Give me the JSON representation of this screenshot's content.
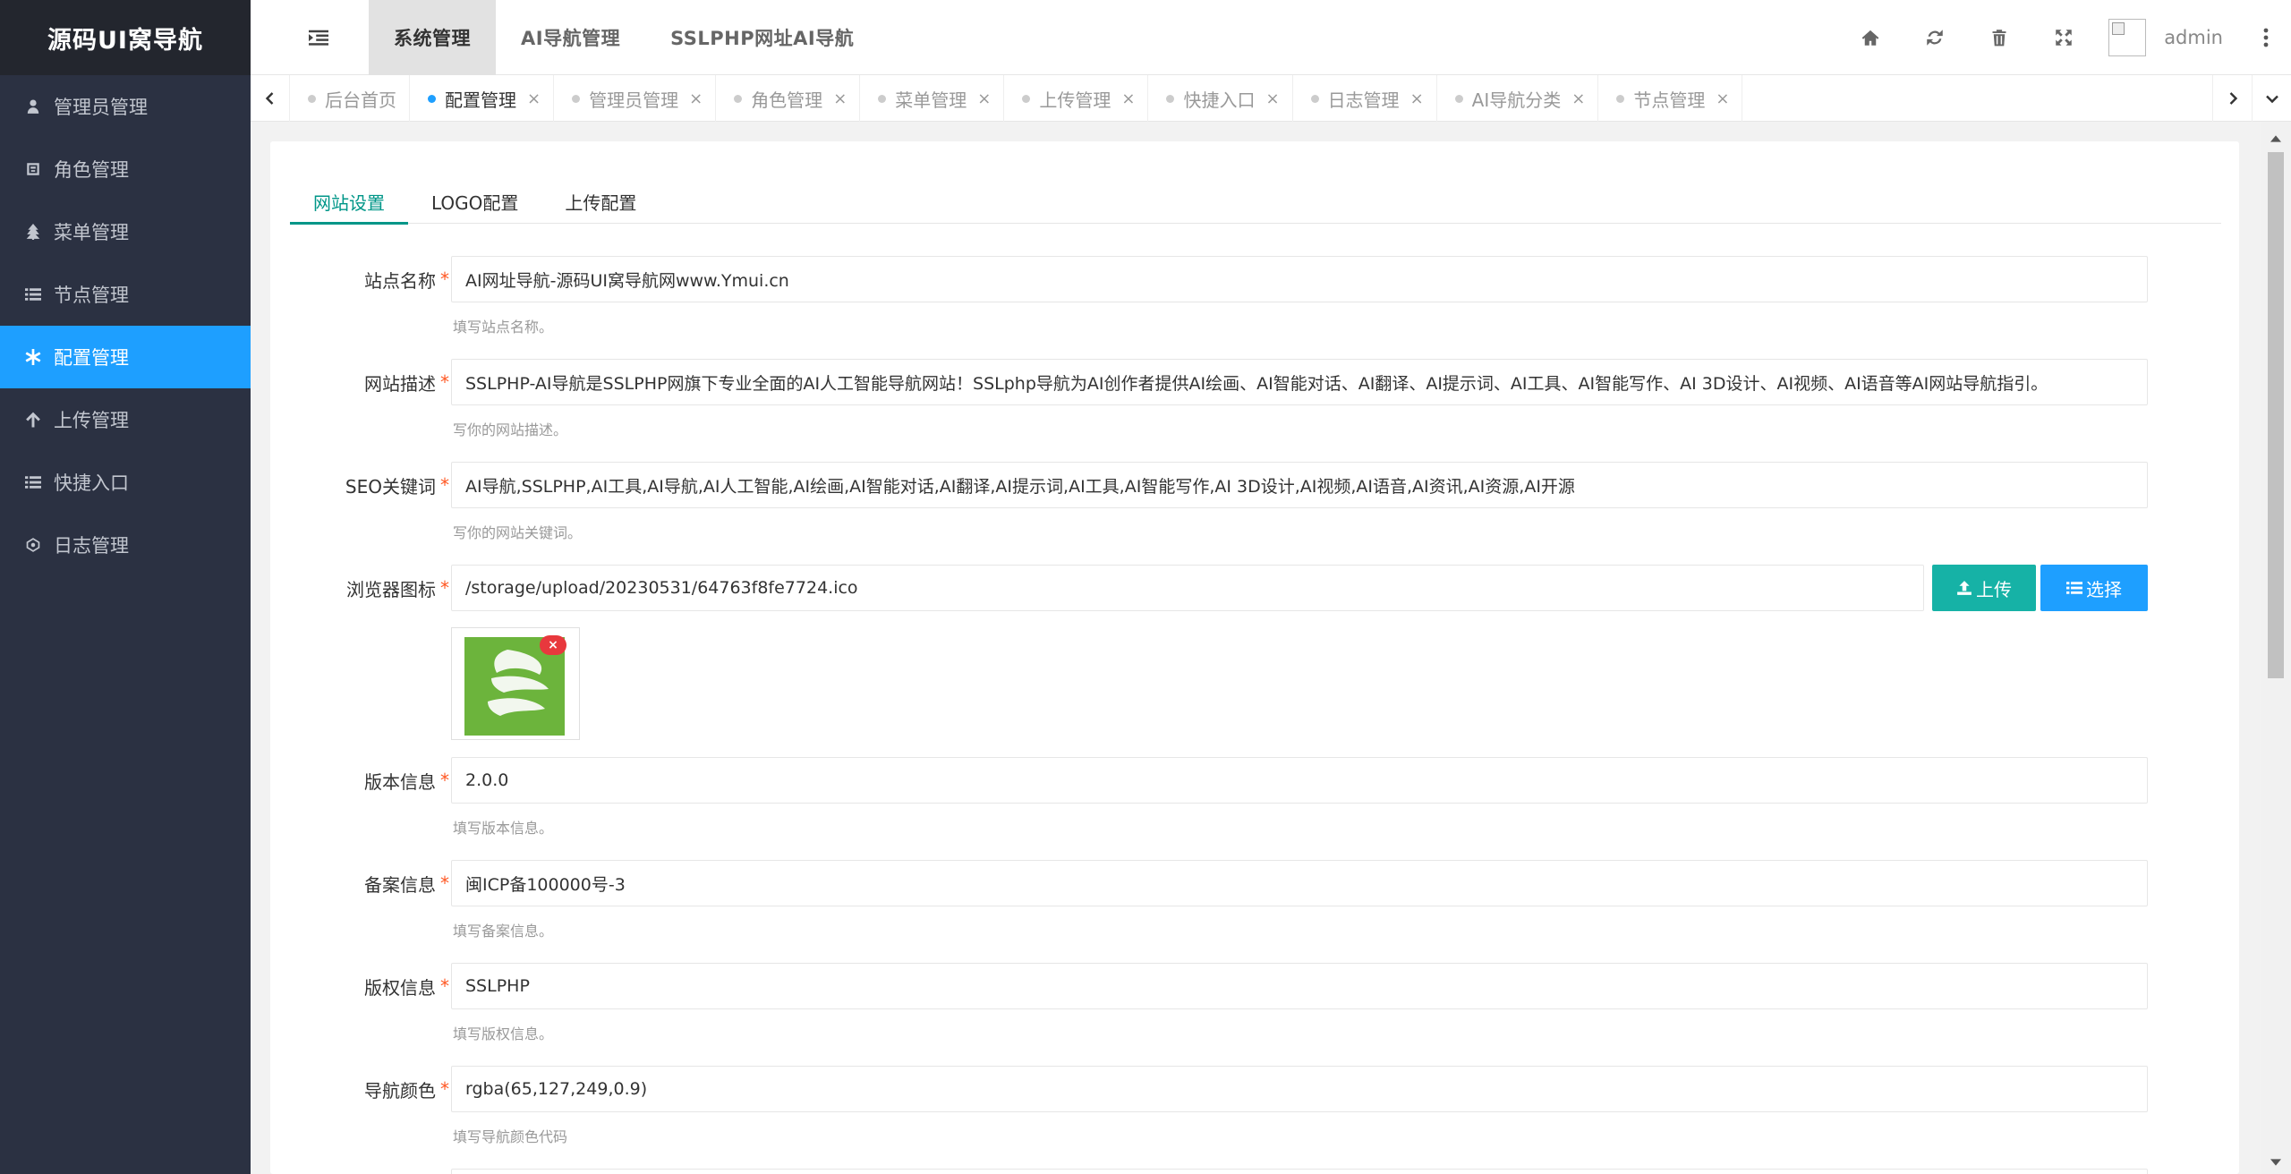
{
  "sidebar": {
    "logo": "源码UI窝导航",
    "items": [
      {
        "label": "管理员管理",
        "icon": "user-icon"
      },
      {
        "label": "角色管理",
        "icon": "role-icon"
      },
      {
        "label": "菜单管理",
        "icon": "tree-icon"
      },
      {
        "label": "节点管理",
        "icon": "list-icon"
      },
      {
        "label": "配置管理",
        "icon": "asterisk-icon",
        "active": true
      },
      {
        "label": "上传管理",
        "icon": "arrow-up-icon"
      },
      {
        "label": "快捷入口",
        "icon": "list-icon"
      },
      {
        "label": "日志管理",
        "icon": "log-icon"
      }
    ]
  },
  "header": {
    "nav": [
      {
        "label": "系统管理",
        "active": true
      },
      {
        "label": "AI导航管理"
      },
      {
        "label": "SSLPHP网址AI导航"
      }
    ],
    "icons": [
      "home-icon",
      "refresh-icon",
      "trash-icon",
      "fullscreen-icon"
    ],
    "user": "admin"
  },
  "tabs": [
    {
      "label": "后台首页",
      "closable": false
    },
    {
      "label": "配置管理",
      "active": true
    },
    {
      "label": "管理员管理"
    },
    {
      "label": "角色管理"
    },
    {
      "label": "菜单管理"
    },
    {
      "label": "上传管理"
    },
    {
      "label": "快捷入口"
    },
    {
      "label": "日志管理"
    },
    {
      "label": "AI导航分类"
    },
    {
      "label": "节点管理"
    }
  ],
  "tab_close": "×",
  "sub_tabs": [
    {
      "label": "网站设置",
      "active": true
    },
    {
      "label": "LOGO配置"
    },
    {
      "label": "上传配置"
    }
  ],
  "form": {
    "site_name": {
      "label": "站点名称",
      "value": "AI网址导航-源码UI窝导航网www.Ymui.cn",
      "help": "填写站点名称。"
    },
    "site_desc": {
      "label": "网站描述",
      "value": "SSLPHP-AI导航是SSLPHP网旗下专业全面的AI人工智能导航网站！SSLphp导航为AI创作者提供AI绘画、AI智能对话、AI翻译、AI提示词、AI工具、AI智能写作、AI 3D设计、AI视频、AI语音等AI网站导航指引。",
      "help": "写你的网站描述。"
    },
    "seo_keywords": {
      "label": "SEO关键词",
      "value": "AI导航,SSLPHP,AI工具,AI导航,AI人工智能,AI绘画,AI智能对话,AI翻译,AI提示词,AI工具,AI智能写作,AI 3D设计,AI视频,AI语音,AI资讯,AI资源,AI开源",
      "help": "写你的网站关键词。"
    },
    "favicon": {
      "label": "浏览器图标",
      "value": "/storage/upload/20230531/64763f8fe7724.ico",
      "upload": "上传",
      "select": "选择",
      "delete": "×"
    },
    "version": {
      "label": "版本信息",
      "value": "2.0.0",
      "help": "填写版本信息。"
    },
    "icp": {
      "label": "备案信息",
      "value": "闽ICP备100000号-3",
      "help": "填写备案信息。"
    },
    "copyright": {
      "label": "版权信息",
      "value": "SSLPHP",
      "help": "填写版权信息。"
    },
    "nav_color": {
      "label": "导航颜色",
      "value": "rgba(65,127,249,0.9)",
      "help": "填写导航颜色代码"
    },
    "required_mark": "*"
  },
  "colors": {
    "accent": "#1e9fff",
    "teal": "#009688",
    "upload_btn": "#16b2a6",
    "sidebar_bg": "#2b3142",
    "required": "#ff5722"
  }
}
